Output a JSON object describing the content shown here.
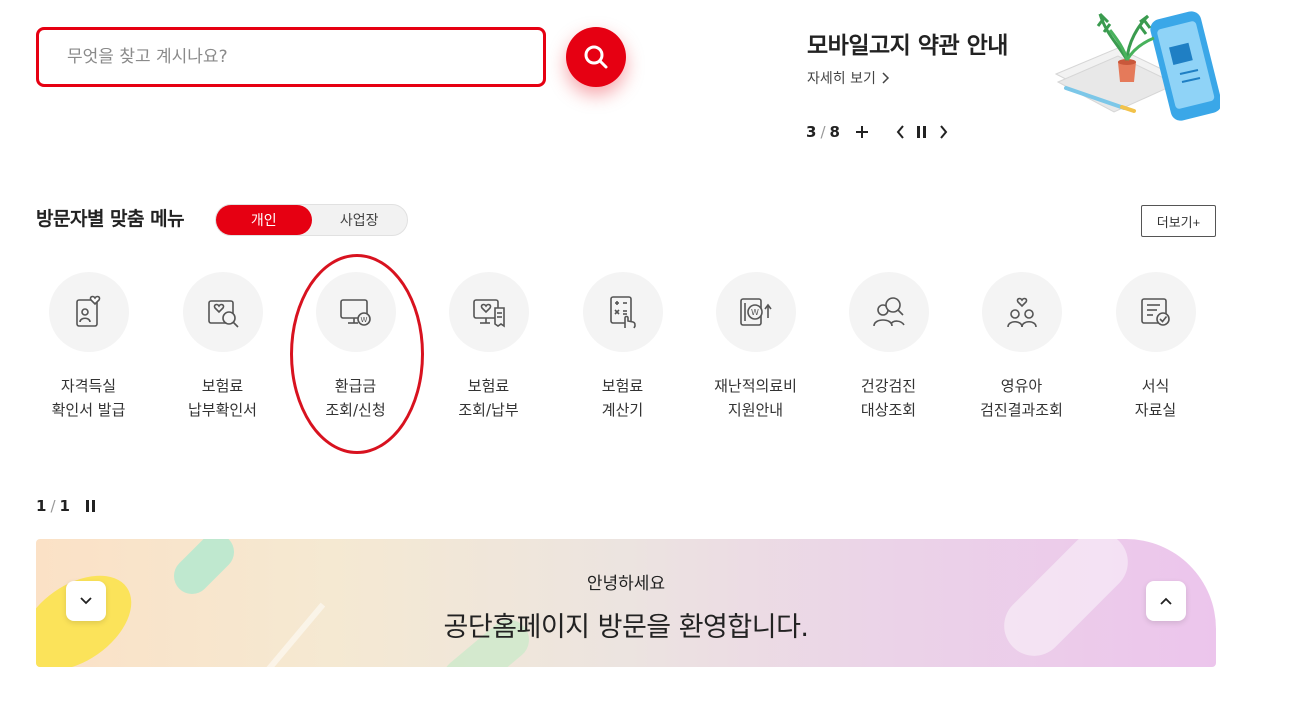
{
  "search": {
    "placeholder": "무엇을 찾고 계시나요?",
    "button_icon": "search-icon"
  },
  "notice": {
    "title": "모바일고지 약관 안내",
    "more_label": "자세히 보기",
    "current": "3",
    "total": "8",
    "icons": [
      "plus-icon",
      "chevron-left-icon",
      "pause-icon",
      "chevron-right-icon"
    ]
  },
  "visitor_menu": {
    "title": "방문자별 맞춤 메뉴",
    "tabs": [
      {
        "label": "개인",
        "active": true
      },
      {
        "label": "사업장",
        "active": false
      }
    ],
    "more_label": "더보기+",
    "items": [
      {
        "line1": "자격득실",
        "line2": "확인서 발급",
        "icon": "id-card-heart-icon"
      },
      {
        "line1": "보험료",
        "line2": "납부확인서",
        "icon": "document-search-icon"
      },
      {
        "line1": "환급금",
        "line2": "조회/신청",
        "icon": "monitor-won-icon"
      },
      {
        "line1": "보험료",
        "line2": "조회/납부",
        "icon": "monitor-receipt-icon"
      },
      {
        "line1": "보험료",
        "line2": "계산기",
        "icon": "calculator-icon"
      },
      {
        "line1": "재난적의료비",
        "line2": "지원안내",
        "icon": "won-up-icon"
      },
      {
        "line1": "건강검진",
        "line2": "대상조회",
        "icon": "people-search-icon"
      },
      {
        "line1": "영유아",
        "line2": "검진결과조회",
        "icon": "family-heart-icon"
      },
      {
        "line1": "서식",
        "line2": "자료실",
        "icon": "form-check-icon"
      }
    ],
    "page_current": "1",
    "page_total": "1"
  },
  "welcome": {
    "sub": "안녕하세요",
    "main": "공단홈페이지 방문을 환영합니다."
  },
  "colors": {
    "accent": "#e60012",
    "ring": "#d8121f",
    "icon_gray": "#555555"
  }
}
